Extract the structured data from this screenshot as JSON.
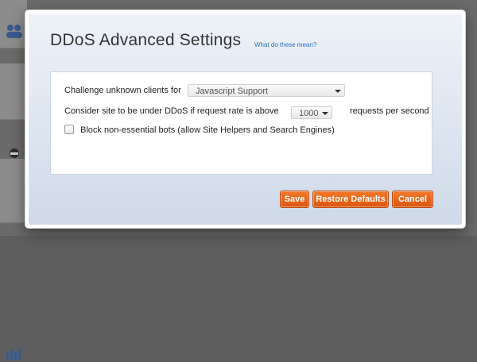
{
  "dialog": {
    "title": "DDoS Advanced Settings",
    "help_link": "What do these mean?"
  },
  "settings": {
    "challenge_label": "Challenge unknown clients for",
    "challenge_value": "Javascript Support",
    "rate_label": "Consider site to be under DDoS if request rate is above",
    "rate_value": "1000",
    "rate_unit": "requests per second",
    "block_bots_label": "Block non-essential bots (allow Site Helpers and Search Engines)",
    "block_bots_checked": false
  },
  "buttons": {
    "save": "Save",
    "restore_defaults": "Restore Defaults",
    "cancel": "Cancel"
  },
  "colors": {
    "accent": "#e8651d",
    "link": "#2a6fc0"
  },
  "background_icons": [
    "users-icon",
    "profile-icon",
    "bar-chart-icon"
  ]
}
